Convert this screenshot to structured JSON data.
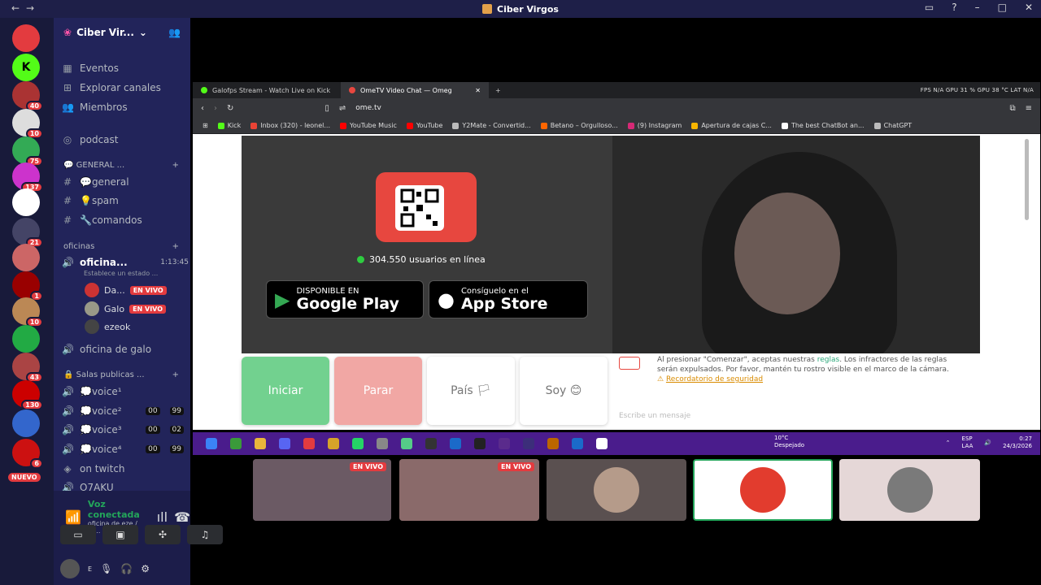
{
  "window": {
    "title": "Ciber Virgos"
  },
  "servers": [
    {
      "name": "discord-home",
      "color": "#e33b3f",
      "label": "",
      "badge": ""
    },
    {
      "name": "kick",
      "color": "#53fc18",
      "label": "K",
      "badge": ""
    },
    {
      "name": "s3",
      "color": "#a33",
      "label": "",
      "badge": "40"
    },
    {
      "name": "s4",
      "color": "#ddd",
      "label": "",
      "badge": "10"
    },
    {
      "name": "s5",
      "color": "#3a5",
      "label": "",
      "badge": "75"
    },
    {
      "name": "s6",
      "color": "#c3c",
      "label": "",
      "badge": "137"
    },
    {
      "name": "s7",
      "color": "#fff",
      "label": "",
      "badge": ""
    },
    {
      "name": "s8",
      "color": "#446",
      "label": "",
      "badge": "21"
    },
    {
      "name": "s9",
      "color": "#c66",
      "label": "",
      "badge": ""
    },
    {
      "name": "s10",
      "color": "#900",
      "label": "",
      "badge": "1"
    },
    {
      "name": "s11",
      "color": "#b85",
      "label": "",
      "badge": "10"
    },
    {
      "name": "s12",
      "color": "#2a4",
      "label": "",
      "badge": ""
    },
    {
      "name": "s13",
      "color": "#a44",
      "label": "",
      "badge": "43"
    },
    {
      "name": "s14",
      "color": "#c00",
      "label": "",
      "badge": "130"
    },
    {
      "name": "s15",
      "color": "#36c",
      "label": "",
      "badge": ""
    },
    {
      "name": "s16",
      "color": "#c11",
      "label": "",
      "badge": "6"
    }
  ],
  "server_badge_new": "NUEVO",
  "guild": {
    "name": "Ciber Vir..."
  },
  "menu": {
    "events": "Eventos",
    "browse": "Explorar canales",
    "members": "Miembros",
    "podcast": "podcast"
  },
  "cat_general": "💬 GENERAL ...",
  "text_channels": [
    "💬general",
    "💡spam",
    "🔧comandos"
  ],
  "cat_offices": "oficinas",
  "active_voice": {
    "name": "oficina...",
    "time": "1:13:45",
    "status": "Establece un estado ..."
  },
  "voice_users": [
    {
      "name": "Da...",
      "live": "EN VIVO"
    },
    {
      "name": "Galo",
      "live": "EN VIVO"
    },
    {
      "name": "ezeok",
      "live": ""
    }
  ],
  "office_galo": "oficina de galo",
  "cat_public": "🔒 Salas publicas ...",
  "public_voice": [
    {
      "name": "💭voice¹",
      "a": "",
      "b": ""
    },
    {
      "name": "💭voice²",
      "a": "00",
      "b": "99"
    },
    {
      "name": "💭voice³",
      "a": "00",
      "b": "02"
    },
    {
      "name": "💭voice⁴",
      "a": "00",
      "b": "99"
    }
  ],
  "on_twitch": "on twitch",
  "otaku": "O7AKU",
  "voice_panel": {
    "title": "Voz conectada",
    "sub": "oficina de eze / Ci..."
  },
  "user_bar": {
    "name": "E"
  },
  "browser": {
    "tabs": [
      {
        "label": "Galofps Stream - Watch Live on Kick",
        "color": "#53fc18"
      },
      {
        "label": "OmeTV Video Chat — Omeg",
        "color": "#e7473f"
      }
    ],
    "stats": "FPS N/A   GPU 31 %   GPU 38 °C   LAT N/A",
    "url": "ome.tv",
    "bookmarks": [
      {
        "label": "Kick",
        "color": "#53fc18"
      },
      {
        "label": "Inbox (320) - leonel...",
        "color": "#ea4335"
      },
      {
        "label": "YouTube Music",
        "color": "#ff0000"
      },
      {
        "label": "YouTube",
        "color": "#ff0000"
      },
      {
        "label": "Y2Mate - Convertid...",
        "color": "#bbb"
      },
      {
        "label": "Betano – Orgulloso...",
        "color": "#f60"
      },
      {
        "label": "(9) Instagram",
        "color": "#d62976"
      },
      {
        "label": "Apertura de cajas C...",
        "color": "#f7b500"
      },
      {
        "label": "The best ChatBot an...",
        "color": "#fff"
      },
      {
        "label": "ChatGPT",
        "color": "#bbb"
      }
    ]
  },
  "ometv": {
    "online": "304.550 usuarios en línea",
    "gplay_small": "DISPONIBLE EN",
    "gplay_big": "Google Play",
    "apple_small": "Consíguelo en el",
    "apple_big": "App Store",
    "btn_start": "Iniciar",
    "btn_stop": "Parar",
    "btn_country": "País 🏳",
    "btn_gender": "Soy 😊",
    "terms_pre": "Al presionar \"Comenzar\", aceptas nuestras ",
    "terms_link": "reglas",
    "terms_post": ". Los infractores de las reglas serán expulsados. Por favor, mantén tu rostro visible en el marco de la cámara.",
    "safety": "Recordatorio de seguridad",
    "type_hint": "Escribe un mensaje"
  },
  "taskbar": {
    "weather_temp": "10°C",
    "weather_desc": "Despejado",
    "lang": "ESP",
    "lang2": "LAA",
    "time": "0:27",
    "date": "24/3/2026"
  },
  "streams": [
    {
      "name": "stream-1",
      "live": "EN VIVO",
      "color": "#6b5a64"
    },
    {
      "name": "stream-2",
      "live": "EN VIVO",
      "color": "#8a6a6a"
    },
    {
      "name": "stream-3",
      "live": "",
      "color": "#5a5050"
    },
    {
      "name": "stream-4",
      "live": "",
      "color": "#ffffff"
    },
    {
      "name": "stream-5",
      "live": "",
      "color": "#e5d7d7"
    }
  ]
}
